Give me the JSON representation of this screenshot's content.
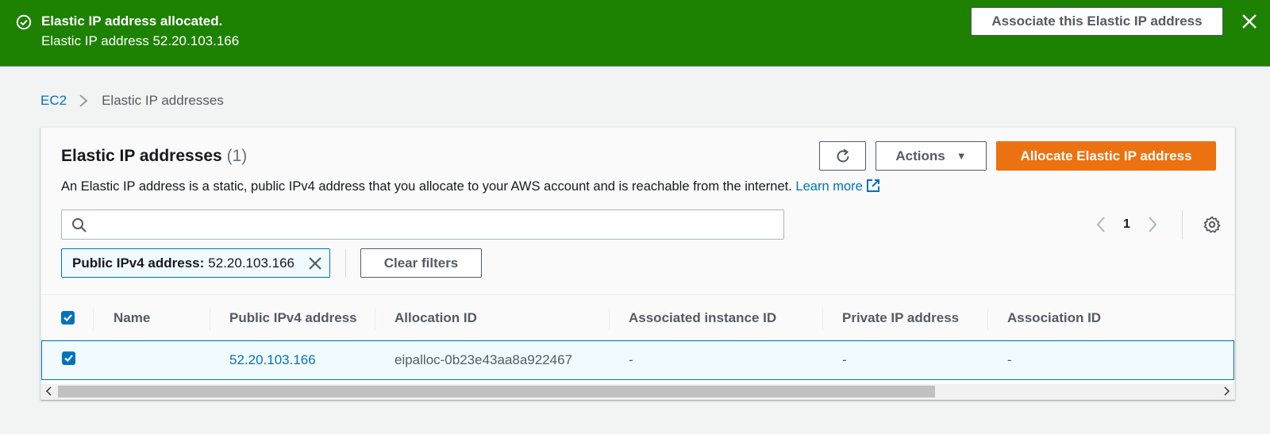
{
  "flash": {
    "title": "Elastic IP address allocated.",
    "subtitle": "Elastic IP address 52.20.103.166",
    "action_label": "Associate this Elastic IP address",
    "color": "#1d8102"
  },
  "breadcrumb": {
    "root": "EC2",
    "current": "Elastic IP addresses"
  },
  "panel": {
    "title": "Elastic IP addresses",
    "count": "(1)",
    "description": "An Elastic IP address is a static, public IPv4 address that you allocate to your AWS account and is reachable from the internet.",
    "learn_more": "Learn more",
    "actions_label": "Actions",
    "allocate_label": "Allocate Elastic IP address",
    "search_placeholder": "",
    "page_number": "1",
    "filter_token": {
      "key": "Public IPv4 address:",
      "value": "52.20.103.166"
    },
    "clear_filters_label": "Clear filters",
    "primary_color": "#ec7211"
  },
  "table": {
    "columns": [
      "Name",
      "Public IPv4 address",
      "Allocation ID",
      "Associated instance ID",
      "Private IP address",
      "Association ID"
    ],
    "rows": [
      {
        "name": "",
        "public_ip": "52.20.103.166",
        "allocation_id": "eipalloc-0b23e43aa8a922467",
        "instance_id": "-",
        "private_ip": "-",
        "association_id": "-",
        "selected": true
      }
    ]
  }
}
